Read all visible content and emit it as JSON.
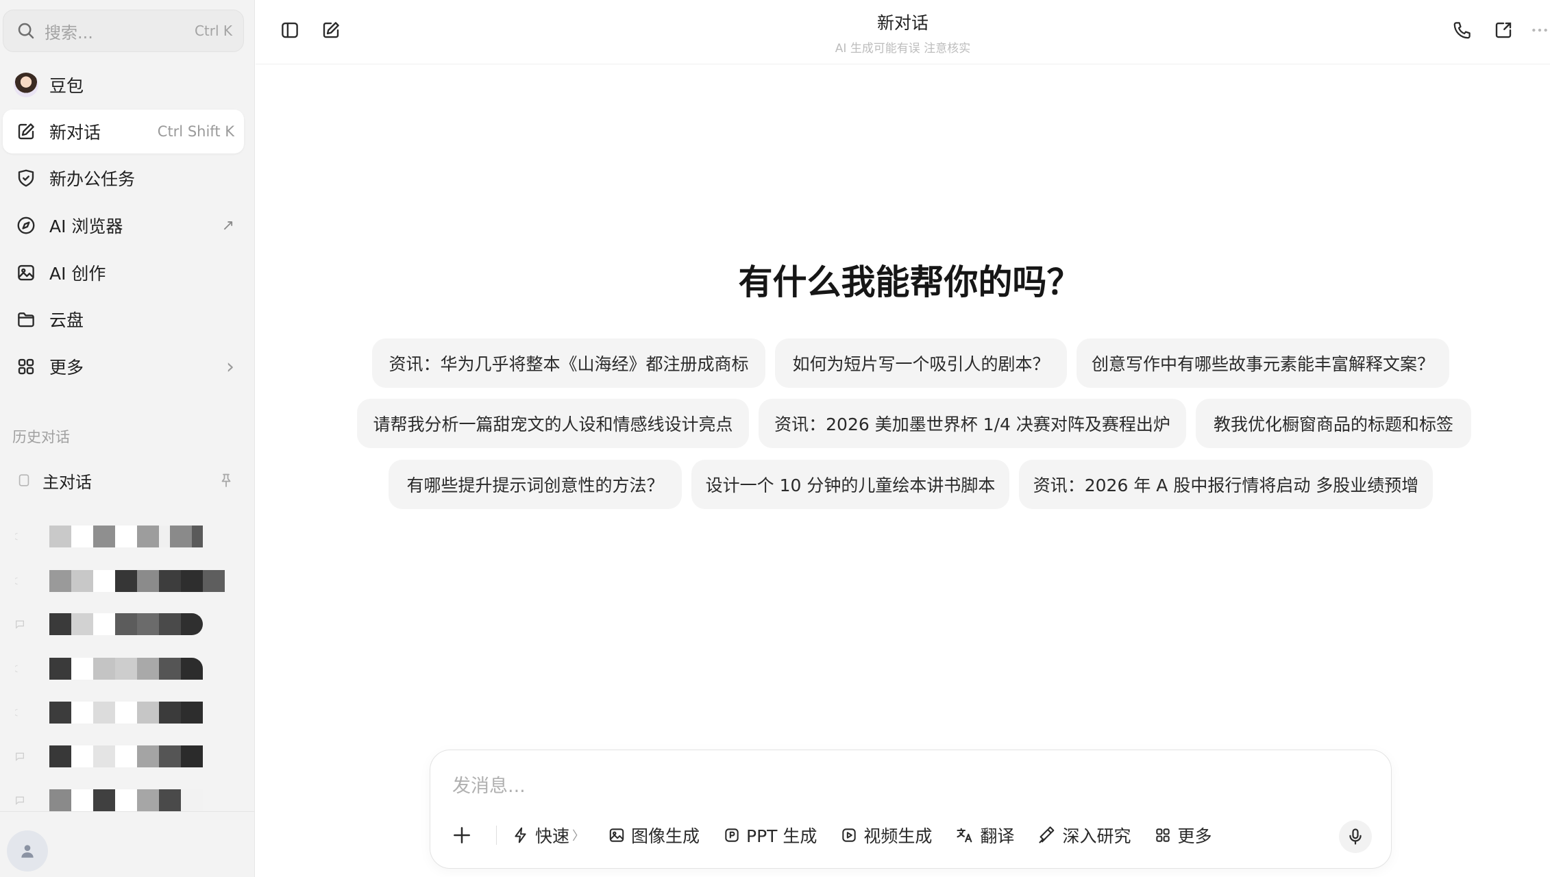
{
  "sidebar": {
    "search": {
      "placeholder": "搜索...",
      "shortcut": "Ctrl K"
    },
    "items": [
      {
        "label": "豆包",
        "icon": "avatar-icon"
      },
      {
        "label": "新对话",
        "shortcut": "Ctrl Shift K",
        "icon": "edit-icon",
        "active": true
      },
      {
        "label": "新办公任务",
        "icon": "task-icon"
      },
      {
        "label": "AI 浏览器",
        "icon": "compass-icon",
        "trailing": "↗"
      },
      {
        "label": "AI 创作",
        "icon": "image-icon"
      },
      {
        "label": "云盘",
        "icon": "folder-icon"
      },
      {
        "label": "更多",
        "icon": "grid-icon",
        "trailing": "›"
      }
    ],
    "history_label": "历史对话",
    "pinned": {
      "label": "主对话",
      "icon": "pin-icon"
    }
  },
  "header": {
    "title": "新对话",
    "subtitle": "AI 生成可能有误 注意核实"
  },
  "main": {
    "headline": "有什么我能帮你的吗？",
    "suggestions": [
      "资讯：华为几乎将整本《山海经》都注册成商标",
      "如何为短片写一个吸引人的剧本？",
      "创意写作中有哪些故事元素能丰富解释文案？",
      "请帮我分析一篇甜宠文的人设和情感线设计亮点",
      "资讯：2026 美加墨世界杯 1/4 决赛对阵及赛程出炉",
      "教我优化橱窗商品的标题和标签",
      "有哪些提升提示词创意性的方法？",
      "设计一个 10 分钟的儿童绘本讲书脚本",
      "资讯：2026 年 A 股中报行情将启动 多股业绩预增"
    ]
  },
  "composer": {
    "placeholder": "发消息...",
    "tools": [
      {
        "label": "快速",
        "icon": "bolt-icon"
      },
      {
        "label": "图像生成",
        "icon": "image-gen-icon"
      },
      {
        "label": "PPT 生成",
        "icon": "ppt-icon"
      },
      {
        "label": "视频生成",
        "icon": "video-icon"
      },
      {
        "label": "翻译",
        "icon": "translate-icon"
      },
      {
        "label": "深入研究",
        "icon": "research-icon"
      },
      {
        "label": "更多",
        "icon": "grid-icon"
      }
    ]
  }
}
